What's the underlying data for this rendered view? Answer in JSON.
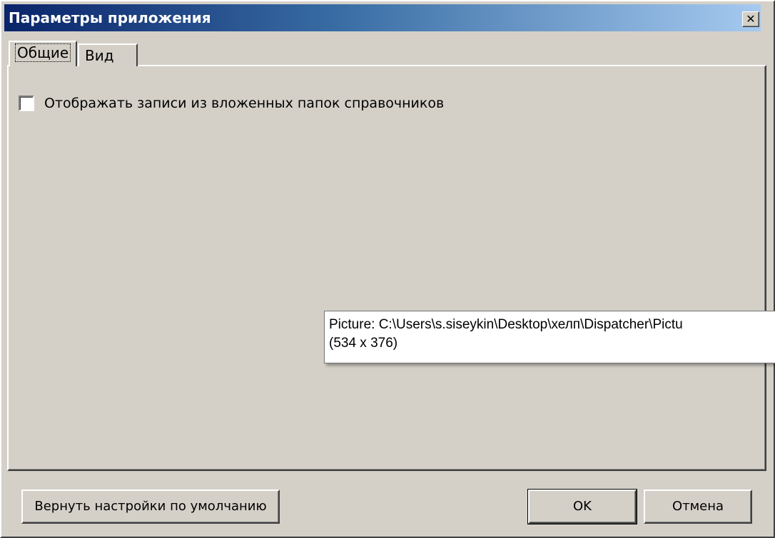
{
  "window": {
    "title": "Параметры приложения",
    "close_label": "✕"
  },
  "tabs": [
    {
      "label": "Общие",
      "selected": true
    },
    {
      "label": "Вид",
      "selected": false
    }
  ],
  "general": {
    "show_nested_records": {
      "label": "Отображать записи из вложенных папок справочников",
      "checked": false
    }
  },
  "tooltip": {
    "line1": "Picture: C:\\Users\\s.siseykin\\Desktop\\хелп\\Dispatcher\\Pictu",
    "line2": "(534 x 376)"
  },
  "buttons": {
    "reset_label": "Вернуть настройки по умолчанию",
    "ok_label": "OK",
    "cancel_label": "Отмена"
  }
}
